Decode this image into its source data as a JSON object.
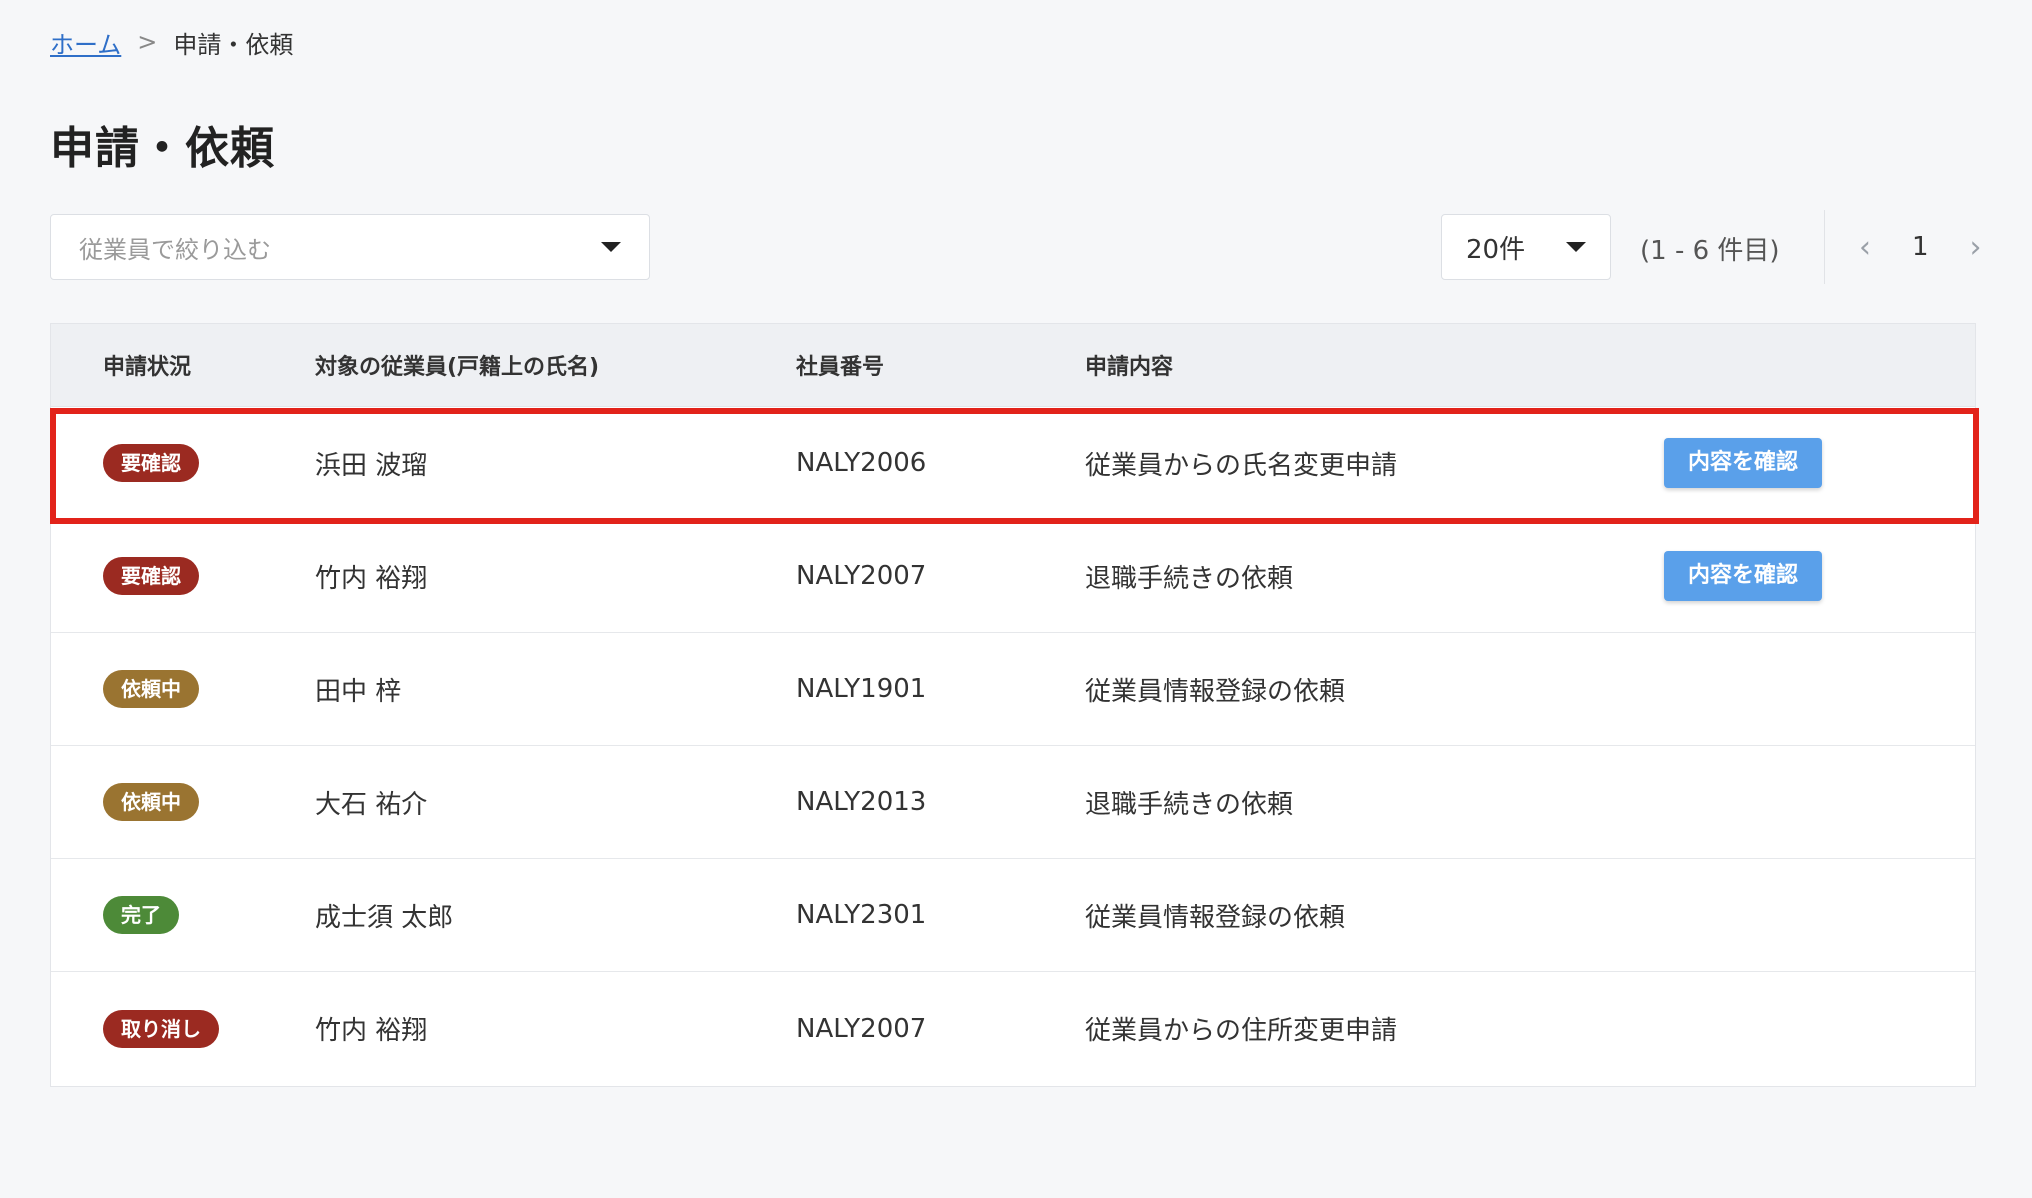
{
  "breadcrumb": {
    "home": "ホーム",
    "separator": ">",
    "current": "申請・依頼"
  },
  "page_title": "申請・依頼",
  "filter": {
    "placeholder": "従業員で絞り込む",
    "icon": "caret-down-icon"
  },
  "pagination": {
    "page_size": "20件",
    "range": "(1 - 6 件目)",
    "prev": "‹",
    "page": "1",
    "next": "›"
  },
  "table": {
    "headers": [
      "申請状況",
      "対象の従業員(戸籍上の氏名)",
      "社員番号",
      "申請内容",
      ""
    ],
    "rows": [
      {
        "status": "要確認",
        "status_color": "#9b2a21",
        "name": "浜田 波瑠",
        "emp_no": "NALY2006",
        "content": "従業員からの氏名変更申請",
        "action": "内容を確認",
        "highlighted": true
      },
      {
        "status": "要確認",
        "status_color": "#9b2a21",
        "name": "竹内 裕翔",
        "emp_no": "NALY2007",
        "content": "退職手続きの依頼",
        "action": "内容を確認"
      },
      {
        "status": "依頼中",
        "status_color": "#9a7431",
        "name": "田中 梓",
        "emp_no": "NALY1901",
        "content": "従業員情報登録の依頼",
        "action": ""
      },
      {
        "status": "依頼中",
        "status_color": "#9a7431",
        "name": "大石 祐介",
        "emp_no": "NALY2013",
        "content": "退職手続きの依頼",
        "action": ""
      },
      {
        "status": "完了",
        "status_color": "#4d8a38",
        "name": "成士須 太郎",
        "emp_no": "NALY2301",
        "content": "従業員情報登録の依頼",
        "action": ""
      },
      {
        "status": "取り消し",
        "status_color": "#9b2a21",
        "name": "竹内 裕翔",
        "emp_no": "NALY2007",
        "content": "従業員からの住所変更申請",
        "action": ""
      }
    ]
  },
  "colors": {
    "link": "#2f6fc8",
    "primary_button": "#5aa0ea",
    "highlight_border": "#e2231a"
  }
}
